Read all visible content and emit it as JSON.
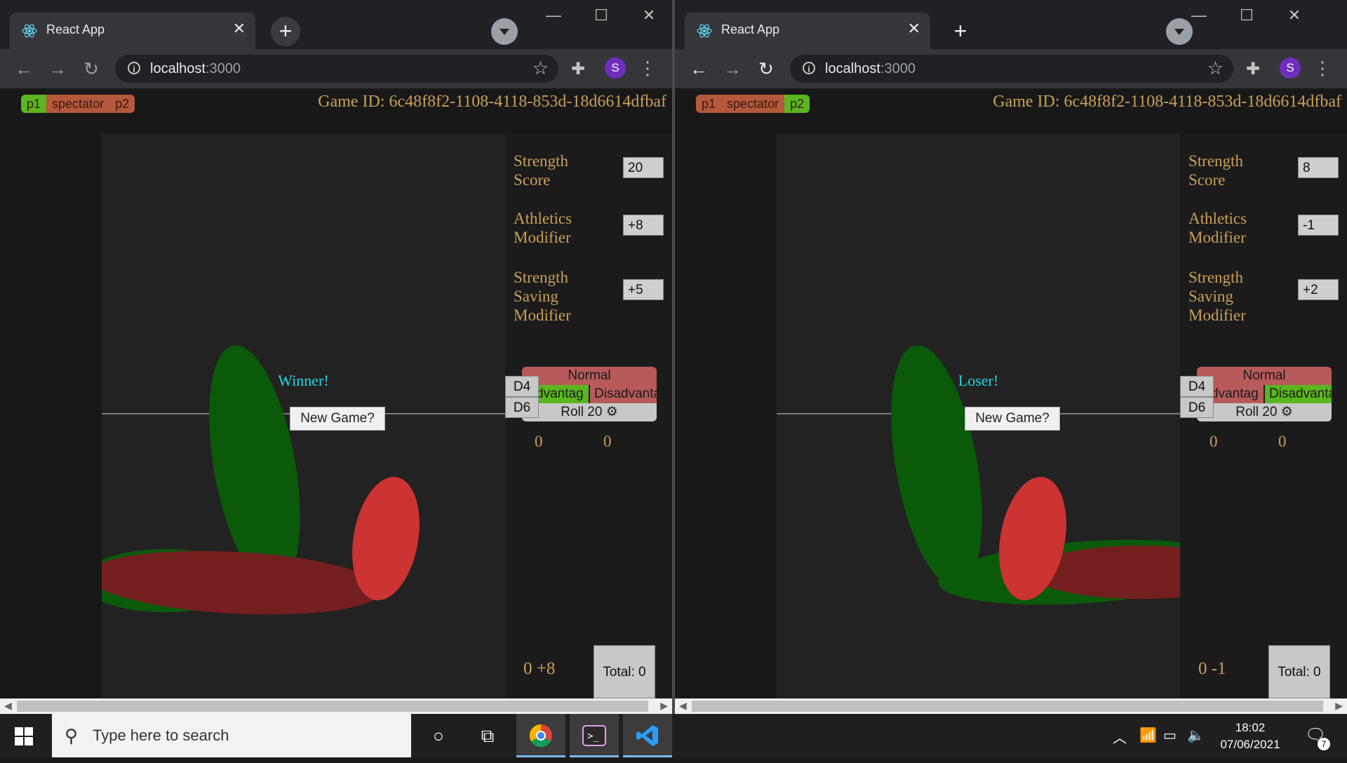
{
  "browser": {
    "tab_title": "React App",
    "url_host": "localhost",
    "url_port": ":3000",
    "avatar_letter": "S"
  },
  "game": {
    "game_id_label": "Game ID: 6c48f8f2-1108-4118-853d-18d6614dfbaf",
    "segments": [
      "p1",
      "spectator",
      "p2"
    ],
    "labels": {
      "strength_score": "Strength\nScore",
      "athletics": "Athletics\nModifier",
      "saving": "Strength\nSaving\nModifier",
      "new_game": "New Game?",
      "normal": "Normal",
      "advantage": "Advantag",
      "disadvantage": "Disadvantag",
      "roll20": "Roll 20 ⚙",
      "d4": "D4",
      "d6": "D6",
      "total": "Total: 0"
    }
  },
  "players": [
    {
      "selected_role": "p1",
      "result": "Winner!",
      "strength_score": "20",
      "athletics_modifier": "+8",
      "saving_modifier": "+5",
      "roll_mode": "Advantage",
      "dice_counts": [
        "0",
        "0"
      ],
      "modifier_line": "0 +8"
    },
    {
      "selected_role": "p2",
      "result": "Loser!",
      "strength_score": "8",
      "athletics_modifier": "-1",
      "saving_modifier": "+2",
      "roll_mode": "Disadvantage",
      "dice_counts": [
        "0",
        "0"
      ],
      "modifier_line": "0 -1"
    }
  ],
  "taskbar": {
    "search_placeholder": "Type here to search",
    "time": "18:02",
    "date": "07/06/2021",
    "notification_count": "7"
  },
  "colors": {
    "gold_text": "#c9a05a",
    "result_text": "#25d6e0",
    "segment_on": "#5ab61f",
    "segment_off": "#b5583c",
    "dark_green": "#0a5a0a",
    "dark_red": "#741f1f",
    "bright_red": "#cc3333"
  }
}
